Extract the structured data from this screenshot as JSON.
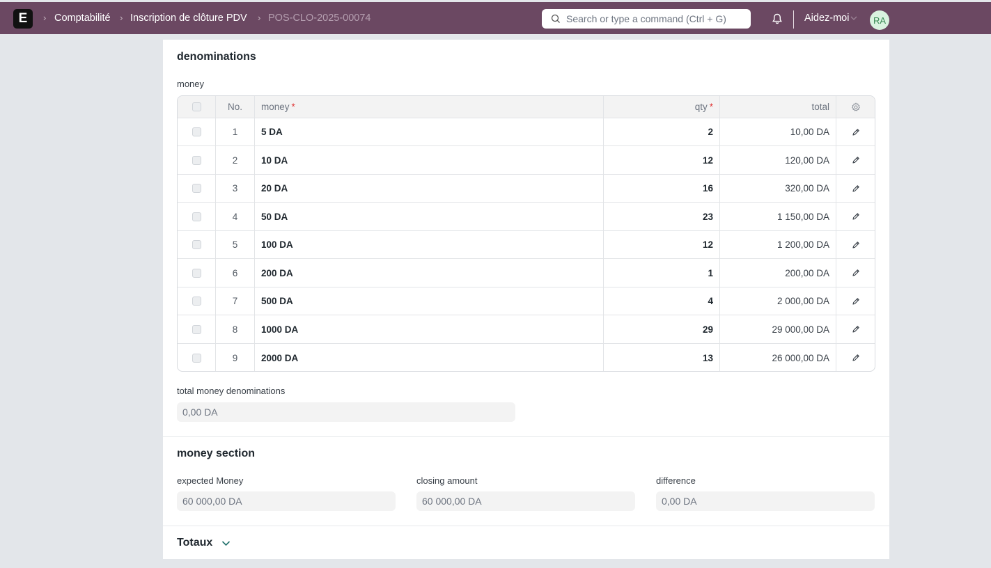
{
  "navbar": {
    "logo_letter": "E",
    "breadcrumbs": [
      "Comptabilité",
      "Inscription de clôture PDV",
      "POS-CLO-2025-00074"
    ],
    "search_placeholder": "Search or type a command (Ctrl + G)",
    "help_label": "Aidez-moi",
    "avatar_initials": "RA"
  },
  "denominations": {
    "title": "denominations",
    "grid_label": "money",
    "columns": {
      "no": "No.",
      "money": "money",
      "qty": "qty",
      "total": "total",
      "required_mark": "*"
    },
    "rows": [
      {
        "no": "1",
        "money": "5 DA",
        "qty": "2",
        "total": "10,00 DA"
      },
      {
        "no": "2",
        "money": "10 DA",
        "qty": "12",
        "total": "120,00 DA"
      },
      {
        "no": "3",
        "money": "20 DA",
        "qty": "16",
        "total": "320,00 DA"
      },
      {
        "no": "4",
        "money": "50 DA",
        "qty": "23",
        "total": "1 150,00 DA"
      },
      {
        "no": "5",
        "money": "100 DA",
        "qty": "12",
        "total": "1 200,00 DA"
      },
      {
        "no": "6",
        "money": "200 DA",
        "qty": "1",
        "total": "200,00 DA"
      },
      {
        "no": "7",
        "money": "500 DA",
        "qty": "4",
        "total": "2 000,00 DA"
      },
      {
        "no": "8",
        "money": "1000 DA",
        "qty": "29",
        "total": "29 000,00 DA"
      },
      {
        "no": "9",
        "money": "2000 DA",
        "qty": "13",
        "total": "26 000,00 DA"
      }
    ],
    "total_label": "total money denominations",
    "total_value": "0,00 DA"
  },
  "money_section": {
    "title": "money section",
    "expected_label": "expected Money",
    "expected_value": "60 000,00 DA",
    "closing_label": "closing amount",
    "closing_value": "60 000,00 DA",
    "difference_label": "difference",
    "difference_value": "0,00 DA"
  },
  "totaux": {
    "title": "Totaux"
  }
}
